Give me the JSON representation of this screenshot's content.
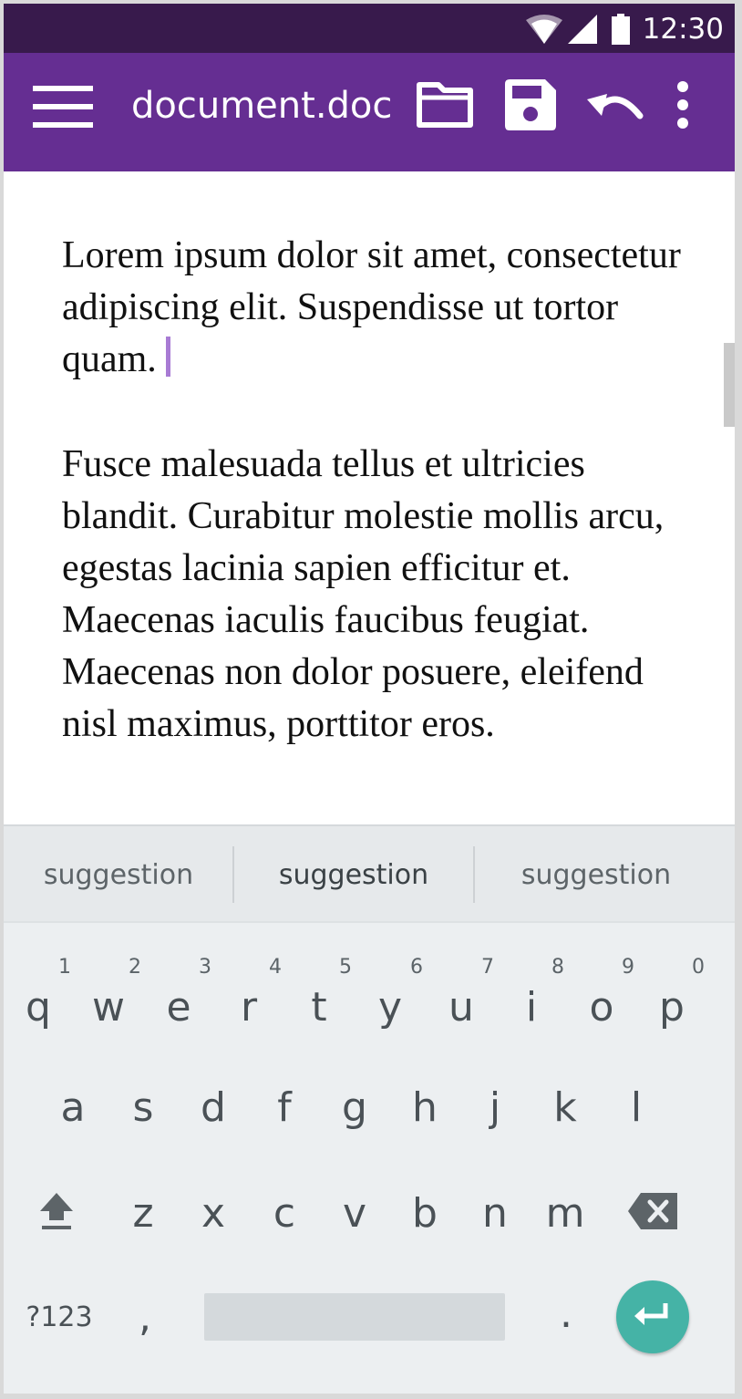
{
  "status_bar": {
    "time": "12:30",
    "icons": [
      "wifi-icon",
      "cellular-signal-icon",
      "battery-icon"
    ]
  },
  "app_bar": {
    "title": "document.doc",
    "menu_icon": "hamburger-menu-icon",
    "actions": [
      "folder-icon",
      "save-icon",
      "undo-icon",
      "more-vert-icon"
    ],
    "color": "#652e92",
    "status_color": "#381a4c"
  },
  "document": {
    "paragraphs": [
      "Lorem ipsum dolor sit amet, consectetur adipiscing elit. Suspendisse ut tortor quam.",
      "Fusce malesuada tellus et ultricies blandit. Curabitur molestie mollis arcu, egestas lacinia sapien efficitur et. Maecenas iaculis faucibus feugiat. Maecenas non dolor posuere, eleifend nisl maximus, porttitor eros."
    ],
    "caret_color": "#a87bd4"
  },
  "keyboard": {
    "suggestions": [
      "suggestion",
      "suggestion",
      "suggestion"
    ],
    "row1": [
      {
        "key": "q",
        "num": "1"
      },
      {
        "key": "w",
        "num": "2"
      },
      {
        "key": "e",
        "num": "3"
      },
      {
        "key": "r",
        "num": "4"
      },
      {
        "key": "t",
        "num": "5"
      },
      {
        "key": "y",
        "num": "6"
      },
      {
        "key": "u",
        "num": "7"
      },
      {
        "key": "i",
        "num": "8"
      },
      {
        "key": "o",
        "num": "9"
      },
      {
        "key": "p",
        "num": "0"
      }
    ],
    "row2": [
      "a",
      "s",
      "d",
      "f",
      "g",
      "h",
      "j",
      "k",
      "l"
    ],
    "row3": [
      "z",
      "x",
      "c",
      "v",
      "b",
      "n",
      "m"
    ],
    "symbols_label": "?123",
    "comma": ",",
    "period": ".",
    "shift_icon": "shift-icon",
    "backspace_icon": "backspace-icon",
    "enter_icon": "enter-icon",
    "enter_color": "#45b3a6"
  }
}
